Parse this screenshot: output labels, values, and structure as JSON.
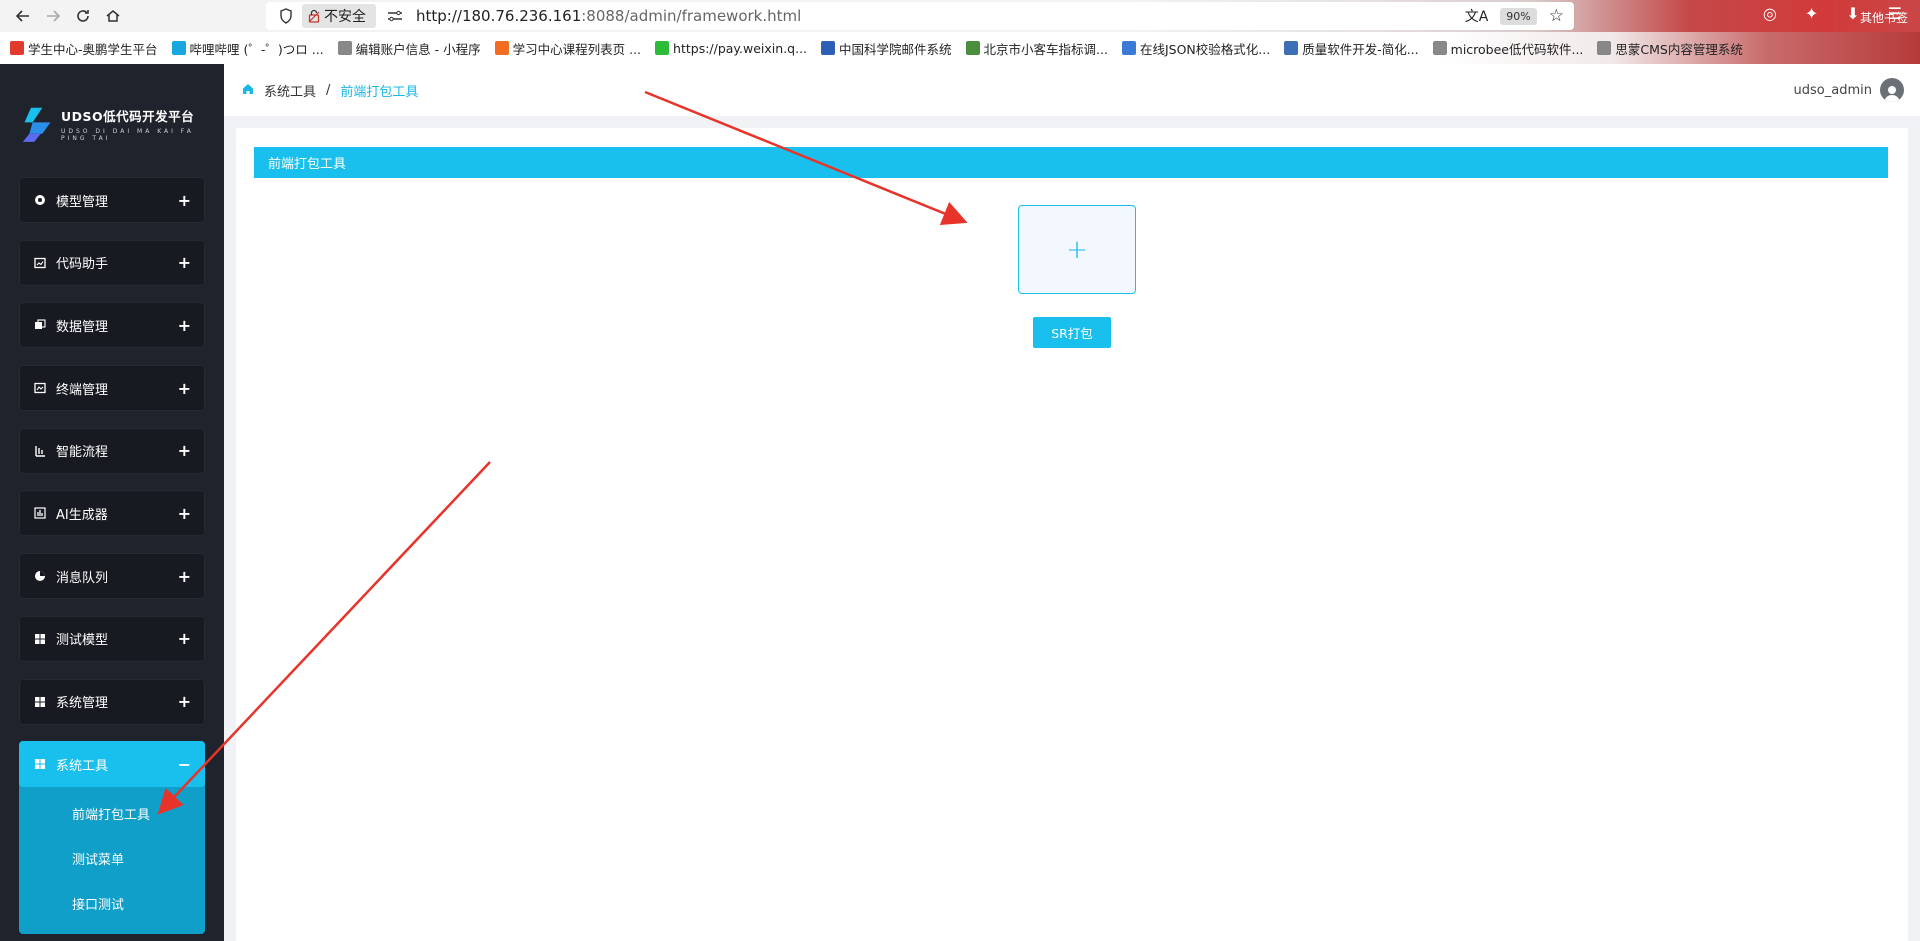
{
  "browser": {
    "security_label": "不安全",
    "url_host": "http://180.76.236.161",
    "url_rest": ":8088/admin/framework.html",
    "zoom": "90%",
    "bookmarks": [
      {
        "label": "学生中心-奥鹏学生平台",
        "color": "#e23b2e"
      },
      {
        "label": "哔哩哔哩 (゜-゜)つロ ...",
        "color": "#19a7e0"
      },
      {
        "label": "编辑账户信息 - 小程序",
        "color": "#888888"
      },
      {
        "label": "学习中心课程列表页 ...",
        "color": "#f26d21"
      },
      {
        "label": "https://pay.weixin.q...",
        "color": "#2dbb3a"
      },
      {
        "label": "中国科学院邮件系统",
        "color": "#2d5fb6"
      },
      {
        "label": "北京市小客车指标调...",
        "color": "#4a8d3c"
      },
      {
        "label": "在线JSON校验格式化...",
        "color": "#3a7bd5"
      },
      {
        "label": "质量软件开发-简化...",
        "color": "#3c6fb5"
      },
      {
        "label": "microbee低代码软件...",
        "color": "#888888"
      },
      {
        "label": "思蒙CMS内容管理系统",
        "color": "#888888"
      }
    ],
    "bookmarks_more": "其他书签"
  },
  "logo": {
    "title": "UDSO低代码开发平台",
    "subtitle": "UDSO DI DAI MA KAI FA PING TAI"
  },
  "sidebar": {
    "items": [
      {
        "label": "模型管理",
        "icon": "model-icon"
      },
      {
        "label": "代码助手",
        "icon": "code-icon"
      },
      {
        "label": "数据管理",
        "icon": "data-icon"
      },
      {
        "label": "终端管理",
        "icon": "terminal-icon"
      },
      {
        "label": "智能流程",
        "icon": "flow-icon"
      },
      {
        "label": "AI生成器",
        "icon": "ai-icon"
      },
      {
        "label": "消息队列",
        "icon": "queue-icon"
      },
      {
        "label": "测试模型",
        "icon": "grid-icon"
      },
      {
        "label": "系统管理",
        "icon": "grid-icon"
      }
    ],
    "active_group": {
      "label": "系统工具",
      "toggle": "−",
      "children": [
        "前端打包工具",
        "测试菜单",
        "接口测试"
      ]
    },
    "expand_symbol": "+"
  },
  "breadcrumb": {
    "parent": "系统工具",
    "separator": "/",
    "current": "前端打包工具"
  },
  "user": {
    "name": "udso_admin"
  },
  "panel": {
    "title": "前端打包工具",
    "upload_symbol": "+",
    "pack_button": "SR打包"
  },
  "colors": {
    "accent": "#19c0ee",
    "sidebar_bg": "#1f232b",
    "annotation_arrow": "#e8332a"
  }
}
